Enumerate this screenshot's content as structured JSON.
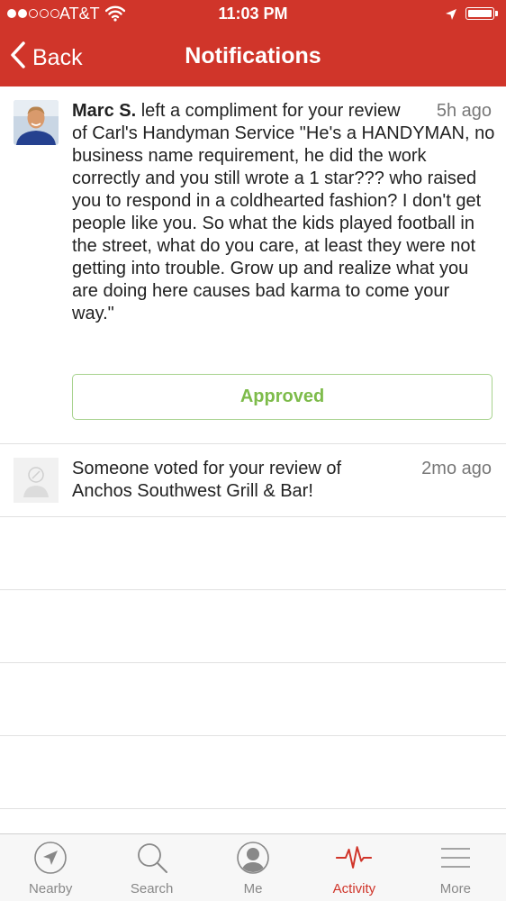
{
  "status_bar": {
    "carrier": "AT&T",
    "time": "11:03 PM",
    "signal_bars": 2,
    "signal_total": 5
  },
  "nav": {
    "back_label": "Back",
    "title": "Notifications"
  },
  "notifications": [
    {
      "user": "Marc S.",
      "message": " left a compliment for your review of Carl's Handyman Service \"He's a HANDYMAN, no business name requirement, he did the work correctly and you still wrote a 1 star??? who raised you to respond in a coldhearted fashion? I don't get people like you. So what the kids played football in the street, what do you care, at least they were not getting into trouble. Grow up and realize what you are doing here causes bad karma to come your way.\"",
      "time": "5h ago",
      "action_label": "Approved"
    },
    {
      "message": "Someone voted for your review of Anchos Southwest Grill & Bar!",
      "time": "2mo ago"
    }
  ],
  "tabs": [
    {
      "label": "Nearby",
      "icon": "navigation-arrow-icon",
      "active": false
    },
    {
      "label": "Search",
      "icon": "search-icon",
      "active": false
    },
    {
      "label": "Me",
      "icon": "profile-icon",
      "active": false
    },
    {
      "label": "Activity",
      "icon": "activity-pulse-icon",
      "active": true
    },
    {
      "label": "More",
      "icon": "menu-icon",
      "active": false
    }
  ],
  "colors": {
    "brand_red": "#d0352a",
    "approved_green": "#7dbb4a",
    "tab_inactive": "#888888"
  }
}
